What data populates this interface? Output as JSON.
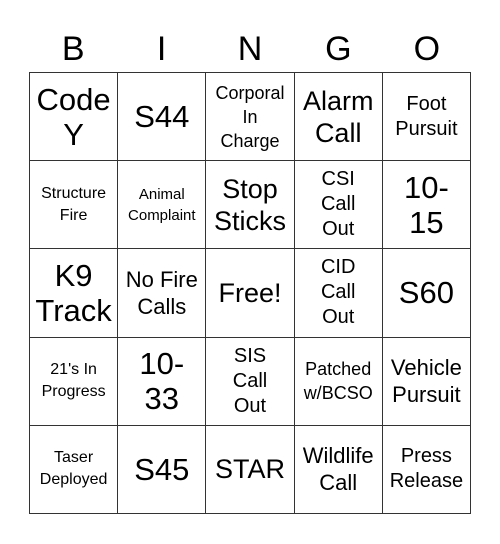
{
  "header": [
    "B",
    "I",
    "N",
    "G",
    "O"
  ],
  "cells": [
    [
      "Code\nY",
      "S44",
      "Corporal\nIn\nCharge",
      "Alarm\nCall",
      "Foot\nPursuit"
    ],
    [
      "Structure\nFire",
      "Animal\nComplaint",
      "Stop\nSticks",
      "CSI\nCall\nOut",
      "10-\n15"
    ],
    [
      "K9\nTrack",
      "No Fire\nCalls",
      "Free!",
      "CID\nCall\nOut",
      "S60"
    ],
    [
      "21's In\nProgress",
      "10-\n33",
      "SIS\nCall\nOut",
      "Patched\nw/BCSO",
      "Vehicle\nPursuit"
    ],
    [
      "Taser\nDeployed",
      "S45",
      "STAR",
      "Wildlife\nCall",
      "Press\nRelease"
    ]
  ]
}
